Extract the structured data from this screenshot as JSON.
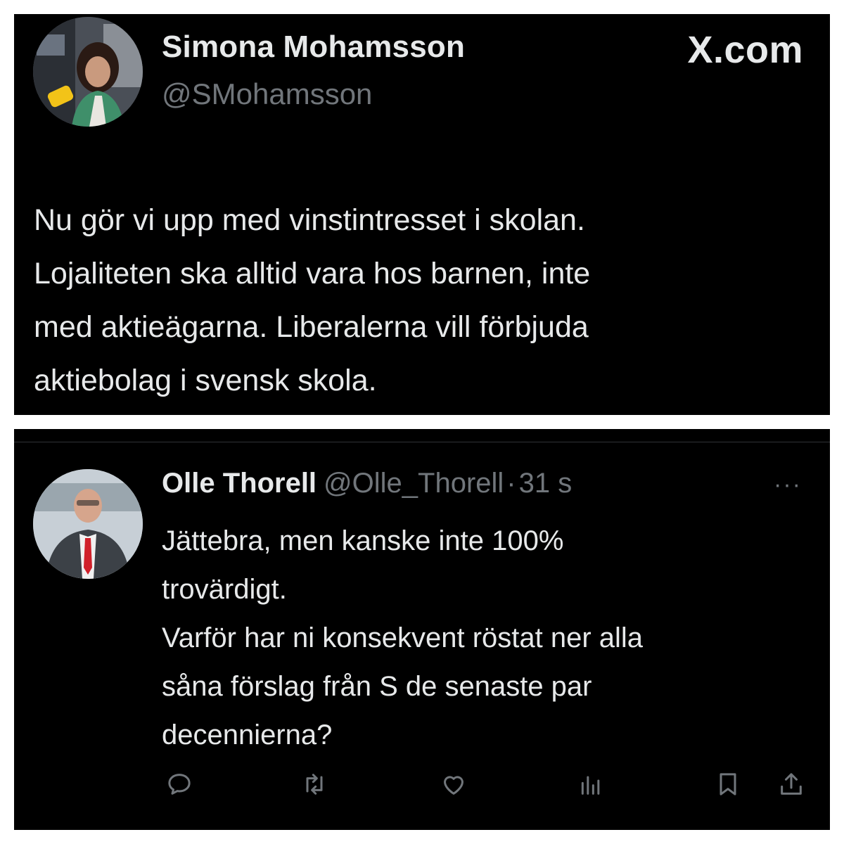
{
  "top_tweet": {
    "author_name": "Simona Mohamsson",
    "author_handle": "@SMohamsson",
    "source_label": "X.com",
    "text": "Nu gör vi upp med vinstintresset i skolan.\nLojaliteten ska alltid vara hos barnen, inte\nmed aktieägarna. Liberalerna vill förbjuda\naktiebolag i svensk skola."
  },
  "reply_tweet": {
    "author_name": "Olle Thorell",
    "author_handle": "@Olle_Thorell",
    "separator": "·",
    "timestamp": "31 s",
    "more_label": "···",
    "text": "Jättebra, men kanske inte 100%\ntrovärdigt.\nVarför har ni konsekvent röstat ner alla\nsåna förslag från S de senaste par\ndecennierna?",
    "actions": [
      {
        "icon": "reply-icon"
      },
      {
        "icon": "retweet-icon"
      },
      {
        "icon": "like-icon"
      },
      {
        "icon": "views-icon"
      },
      {
        "icon": "bookmark-icon"
      },
      {
        "icon": "share-icon"
      }
    ]
  },
  "colors": {
    "background": "#000000",
    "text_primary": "#e7e9ea",
    "text_secondary": "#71767b",
    "page_border": "#ffffff"
  }
}
